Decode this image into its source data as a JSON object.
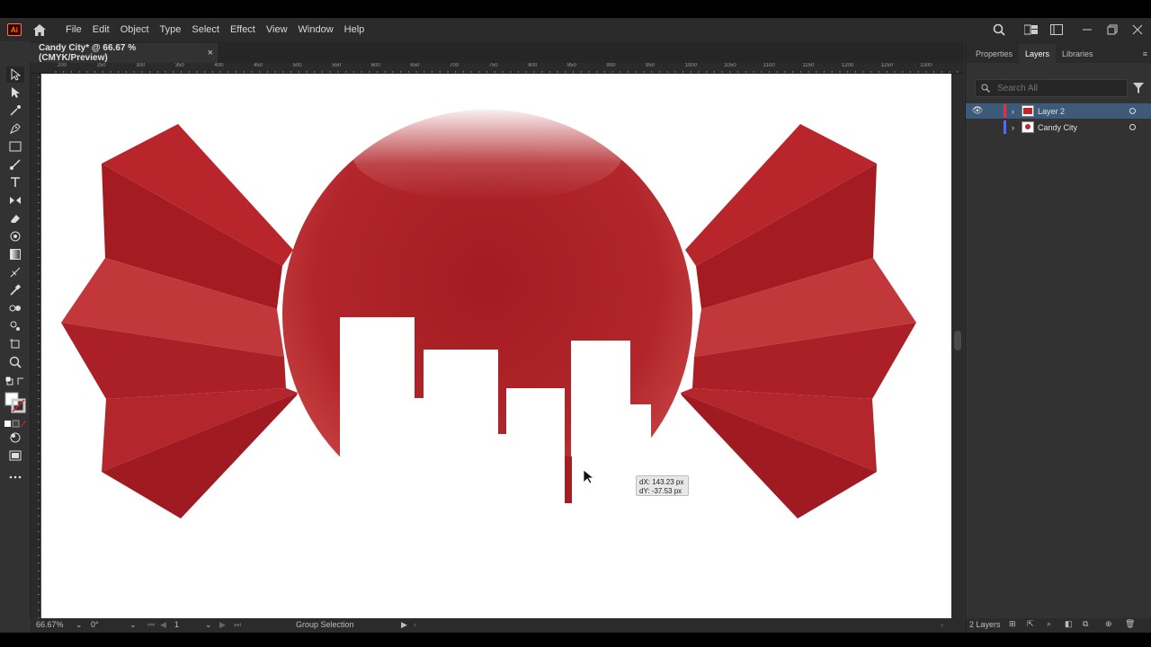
{
  "app": {
    "logo_text": "Ai"
  },
  "menu": [
    "File",
    "Edit",
    "Object",
    "Type",
    "Select",
    "Effect",
    "View",
    "Window",
    "Help"
  ],
  "document_tab": {
    "title": "Candy City* @ 66.67 % (CMYK/Preview)",
    "close_glyph": "×"
  },
  "ruler_ticks": [
    "200",
    "250",
    "300",
    "350",
    "400",
    "450",
    "500",
    "550",
    "600",
    "650",
    "700",
    "750",
    "800",
    "850",
    "900",
    "950",
    "1000",
    "1050",
    "1100",
    "1150",
    "1200",
    "1250",
    "1300"
  ],
  "hud": {
    "dx": "dX: 143.23 px",
    "dy": "dY: -37.53 px"
  },
  "status": {
    "zoom": "66.67%",
    "rotation": "0°",
    "artboard": "1",
    "tool": "Group Selection"
  },
  "panel": {
    "tabs": [
      "Properties",
      "Layers",
      "Libraries"
    ],
    "active_tab": "Layers",
    "search_placeholder": "Search All",
    "layers": [
      {
        "name": "Layer 2",
        "color": "#e6323c",
        "selected": true,
        "visible": true
      },
      {
        "name": "Candy City",
        "color": "#4f6cff",
        "selected": false,
        "visible": false
      }
    ],
    "footer_count": "2 Layers"
  },
  "colors": {
    "candy_red": "#b8262c",
    "candy_dark": "#9e1c22",
    "candy_light": "#c63a3a",
    "selection": "#3e5a79"
  }
}
